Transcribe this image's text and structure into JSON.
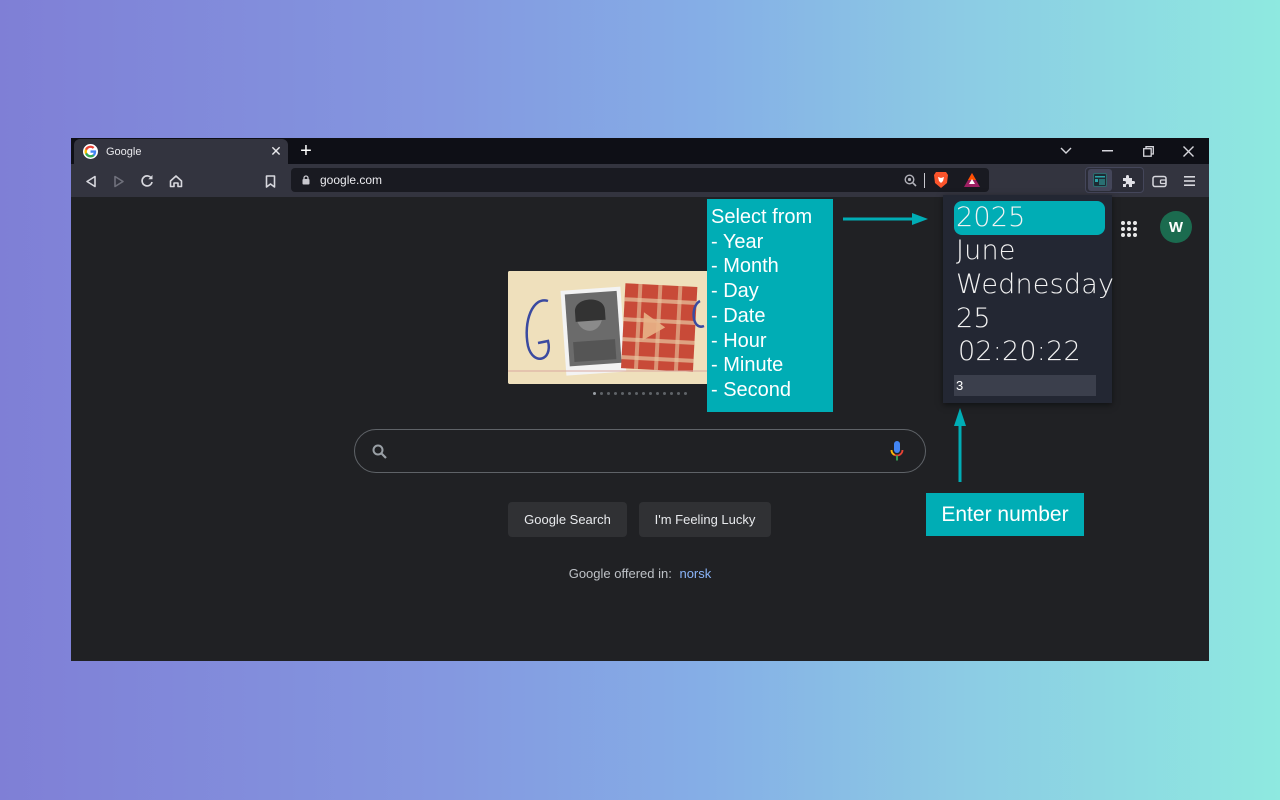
{
  "browser": {
    "tab": {
      "title": "Google",
      "favicon": "google-g-icon"
    },
    "new_tab_label": "+",
    "url": "google.com",
    "window_controls": [
      "chevron-down-icon",
      "minimize-icon",
      "restore-icon",
      "close-icon"
    ],
    "nav_icons": [
      "back-icon",
      "forward-icon",
      "reload-icon",
      "home-icon",
      "bookmark-icon"
    ],
    "extension_icons": [
      "zoom-icon",
      "brave-shields-icon",
      "brave-rewards-icon",
      "calendar-extension-icon",
      "puzzle-icon",
      "wallet-icon",
      "menu-icon"
    ]
  },
  "google": {
    "avatar_letter": "W",
    "search_placeholder": "",
    "search_button": "Google Search",
    "lucky_button": "I'm Feeling Lucky",
    "offered_in": "Google offered in:",
    "language_link": "norsk",
    "doodle_pages": 14,
    "doodle_active_page": 1
  },
  "extension_popup": {
    "rows": [
      "2025",
      "June",
      "Wednesday",
      "25",
      "02:20:22"
    ],
    "selected_index": 0,
    "input_value": "3"
  },
  "annotations": {
    "select_text": "Select from\n- Year\n- Month\n- Day\n- Date\n- Hour\n- Minute\n- Second",
    "enter_text": "Enter number"
  },
  "colors": {
    "accent": "#00adb5",
    "avatar": "#1b6b4f",
    "link": "#8ab4f8"
  }
}
